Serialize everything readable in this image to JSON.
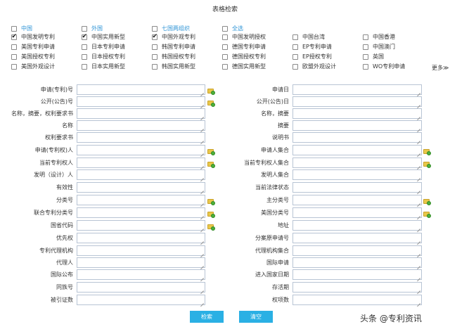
{
  "page": {
    "title": "表格检索"
  },
  "scope_row": [
    {
      "label": "中国",
      "checked": false,
      "color": "#2e94d6"
    },
    {
      "label": "外国",
      "checked": false,
      "color": "#2e94d6"
    },
    {
      "label": "七国两组织",
      "checked": false,
      "color": "#2e94d6"
    },
    {
      "label": "全选",
      "checked": false,
      "color": "#2e94d6"
    }
  ],
  "db_rows": [
    [
      {
        "label": "中国发明专利",
        "checked": true
      },
      {
        "label": "中国实用新型",
        "checked": true
      },
      {
        "label": "中国外观专利",
        "checked": true
      },
      {
        "label": "中国发明授权",
        "checked": false
      },
      {
        "label": "中国台湾",
        "checked": false
      },
      {
        "label": "中国香港",
        "checked": false
      }
    ],
    [
      {
        "label": "美国专利申请",
        "checked": false
      },
      {
        "label": "日本专利申请",
        "checked": false
      },
      {
        "label": "韩国专利申请",
        "checked": false
      },
      {
        "label": "德国专利申请",
        "checked": false
      },
      {
        "label": "EP专利申请",
        "checked": false
      },
      {
        "label": "中国澳门",
        "checked": false
      }
    ],
    [
      {
        "label": "美国授权专利",
        "checked": false
      },
      {
        "label": "日本授权专利",
        "checked": false
      },
      {
        "label": "韩国授权专利",
        "checked": false
      },
      {
        "label": "德国授权专利",
        "checked": false
      },
      {
        "label": "EP授权专利",
        "checked": false
      },
      {
        "label": "英国",
        "checked": false
      }
    ],
    [
      {
        "label": "美国外观设计",
        "checked": false
      },
      {
        "label": "日本实用新型",
        "checked": false
      },
      {
        "label": "韩国实用新型",
        "checked": false
      },
      {
        "label": "德国实用新型",
        "checked": false
      },
      {
        "label": "欧盟外观设计",
        "checked": false
      },
      {
        "label": "WO专利申请",
        "checked": false
      }
    ]
  ],
  "more_label": "更多≫",
  "form_left": [
    {
      "label": "申请(专利)号",
      "has_folder": true
    },
    {
      "label": "公开(公告)号",
      "has_folder": true
    },
    {
      "label": "名称，摘要，权利要求书",
      "has_folder": false
    },
    {
      "label": "名称",
      "has_folder": false
    },
    {
      "label": "权利要求书",
      "has_folder": false
    },
    {
      "label": "申请(专利权)人",
      "has_folder": true
    },
    {
      "label": "当前专利权人",
      "has_folder": true
    },
    {
      "label": "发明（设计）人",
      "has_folder": false
    },
    {
      "label": "有效性",
      "has_folder": false
    },
    {
      "label": "分类号",
      "has_folder": true
    },
    {
      "label": "联合专利分类号",
      "has_folder": true
    },
    {
      "label": "国省代码",
      "has_folder": true
    },
    {
      "label": "优先权",
      "has_folder": false
    },
    {
      "label": "专利代理机构",
      "has_folder": false
    },
    {
      "label": "代理人",
      "has_folder": false
    },
    {
      "label": "国际公布",
      "has_folder": false
    },
    {
      "label": "同族号",
      "has_folder": false
    },
    {
      "label": "被引证数",
      "has_folder": false
    }
  ],
  "form_right": [
    {
      "label": "申请日",
      "has_folder": false
    },
    {
      "label": "公开(公告)日",
      "has_folder": false
    },
    {
      "label": "名称，摘要",
      "has_folder": false
    },
    {
      "label": "摘要",
      "has_folder": false
    },
    {
      "label": "说明书",
      "has_folder": false
    },
    {
      "label": "申请人集合",
      "has_folder": true
    },
    {
      "label": "当前专利权人集合",
      "has_folder": true
    },
    {
      "label": "发明人集合",
      "has_folder": false
    },
    {
      "label": "当前法律状态",
      "has_folder": false
    },
    {
      "label": "主分类号",
      "has_folder": true
    },
    {
      "label": "美国分类号",
      "has_folder": true
    },
    {
      "label": "地址",
      "has_folder": false
    },
    {
      "label": "分案原申请号",
      "has_folder": false
    },
    {
      "label": "代理机构集合",
      "has_folder": false
    },
    {
      "label": "国际申请",
      "has_folder": false
    },
    {
      "label": "进入国家日期",
      "has_folder": false
    },
    {
      "label": "存活期",
      "has_folder": false
    },
    {
      "label": "权项数",
      "has_folder": false
    }
  ],
  "buttons": {
    "search": "检索",
    "clear": "清空"
  },
  "watermark": "头条 @专利资讯"
}
